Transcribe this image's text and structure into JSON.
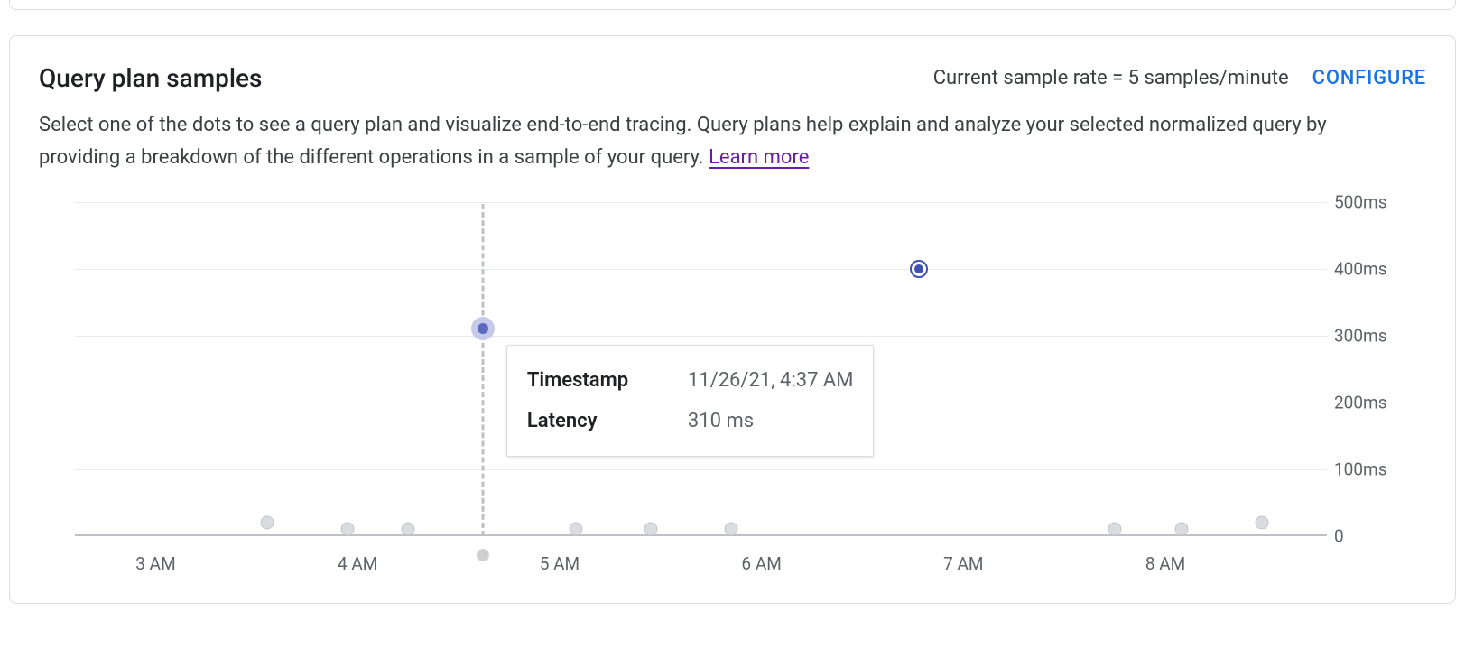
{
  "header": {
    "title": "Query plan samples",
    "sample_rate_text": "Current sample rate = 5 samples/minute",
    "configure_label": "CONFIGURE"
  },
  "description": {
    "text": "Select one of the dots to see a query plan and visualize end-to-end tracing. Query plans help explain and analyze your selected normalized query by providing a breakdown of the different operations in a sample of your query. ",
    "learn_more_label": "Learn more"
  },
  "tooltip": {
    "timestamp_label": "Timestamp",
    "timestamp_value": "11/26/21, 4:37 AM",
    "latency_label": "Latency",
    "latency_value": "310 ms"
  },
  "chart_data": {
    "type": "scatter",
    "title": "",
    "xlabel": "",
    "ylabel": "",
    "ylim": [
      0,
      500
    ],
    "y_tick_labels": [
      "0",
      "100ms",
      "200ms",
      "300ms",
      "400ms",
      "500ms"
    ],
    "y_tick_values": [
      0,
      100,
      200,
      300,
      400,
      500
    ],
    "x_range_hours": [
      2.6,
      8.8
    ],
    "x_tick_labels": [
      "3 AM",
      "4 AM",
      "5 AM",
      "6 AM",
      "7 AM",
      "8 AM"
    ],
    "x_tick_hours": [
      3,
      4,
      5,
      6,
      7,
      8
    ],
    "hovered_index": 4,
    "selected_index": 9,
    "points": [
      {
        "hour": 3.55,
        "latency_ms": 20,
        "timestamp": "11/26/21, 3:33 AM"
      },
      {
        "hour": 3.95,
        "latency_ms": 10,
        "timestamp": "11/26/21, 3:57 AM"
      },
      {
        "hour": 4.25,
        "latency_ms": 10,
        "timestamp": "11/26/21, 4:15 AM"
      },
      {
        "hour": 4.62,
        "latency_ms": 310,
        "timestamp": "11/26/21, 4:37 AM"
      },
      {
        "hour": 4.62,
        "latency_ms": 310,
        "timestamp": "11/26/21, 4:37 AM"
      },
      {
        "hour": 5.08,
        "latency_ms": 10,
        "timestamp": "11/26/21, 5:05 AM"
      },
      {
        "hour": 5.45,
        "latency_ms": 10,
        "timestamp": "11/26/21, 5:27 AM"
      },
      {
        "hour": 5.85,
        "latency_ms": 10,
        "timestamp": "11/26/21, 5:51 AM"
      },
      {
        "hour": 6.78,
        "latency_ms": 400,
        "timestamp": "11/26/21, 6:47 AM"
      },
      {
        "hour": 6.78,
        "latency_ms": 400,
        "timestamp": "11/26/21, 6:47 AM"
      },
      {
        "hour": 7.75,
        "latency_ms": 10,
        "timestamp": "11/26/21, 7:45 AM"
      },
      {
        "hour": 8.08,
        "latency_ms": 10,
        "timestamp": "11/26/21, 8:05 AM"
      },
      {
        "hour": 8.48,
        "latency_ms": 20,
        "timestamp": "11/26/21, 8:29 AM"
      }
    ]
  }
}
